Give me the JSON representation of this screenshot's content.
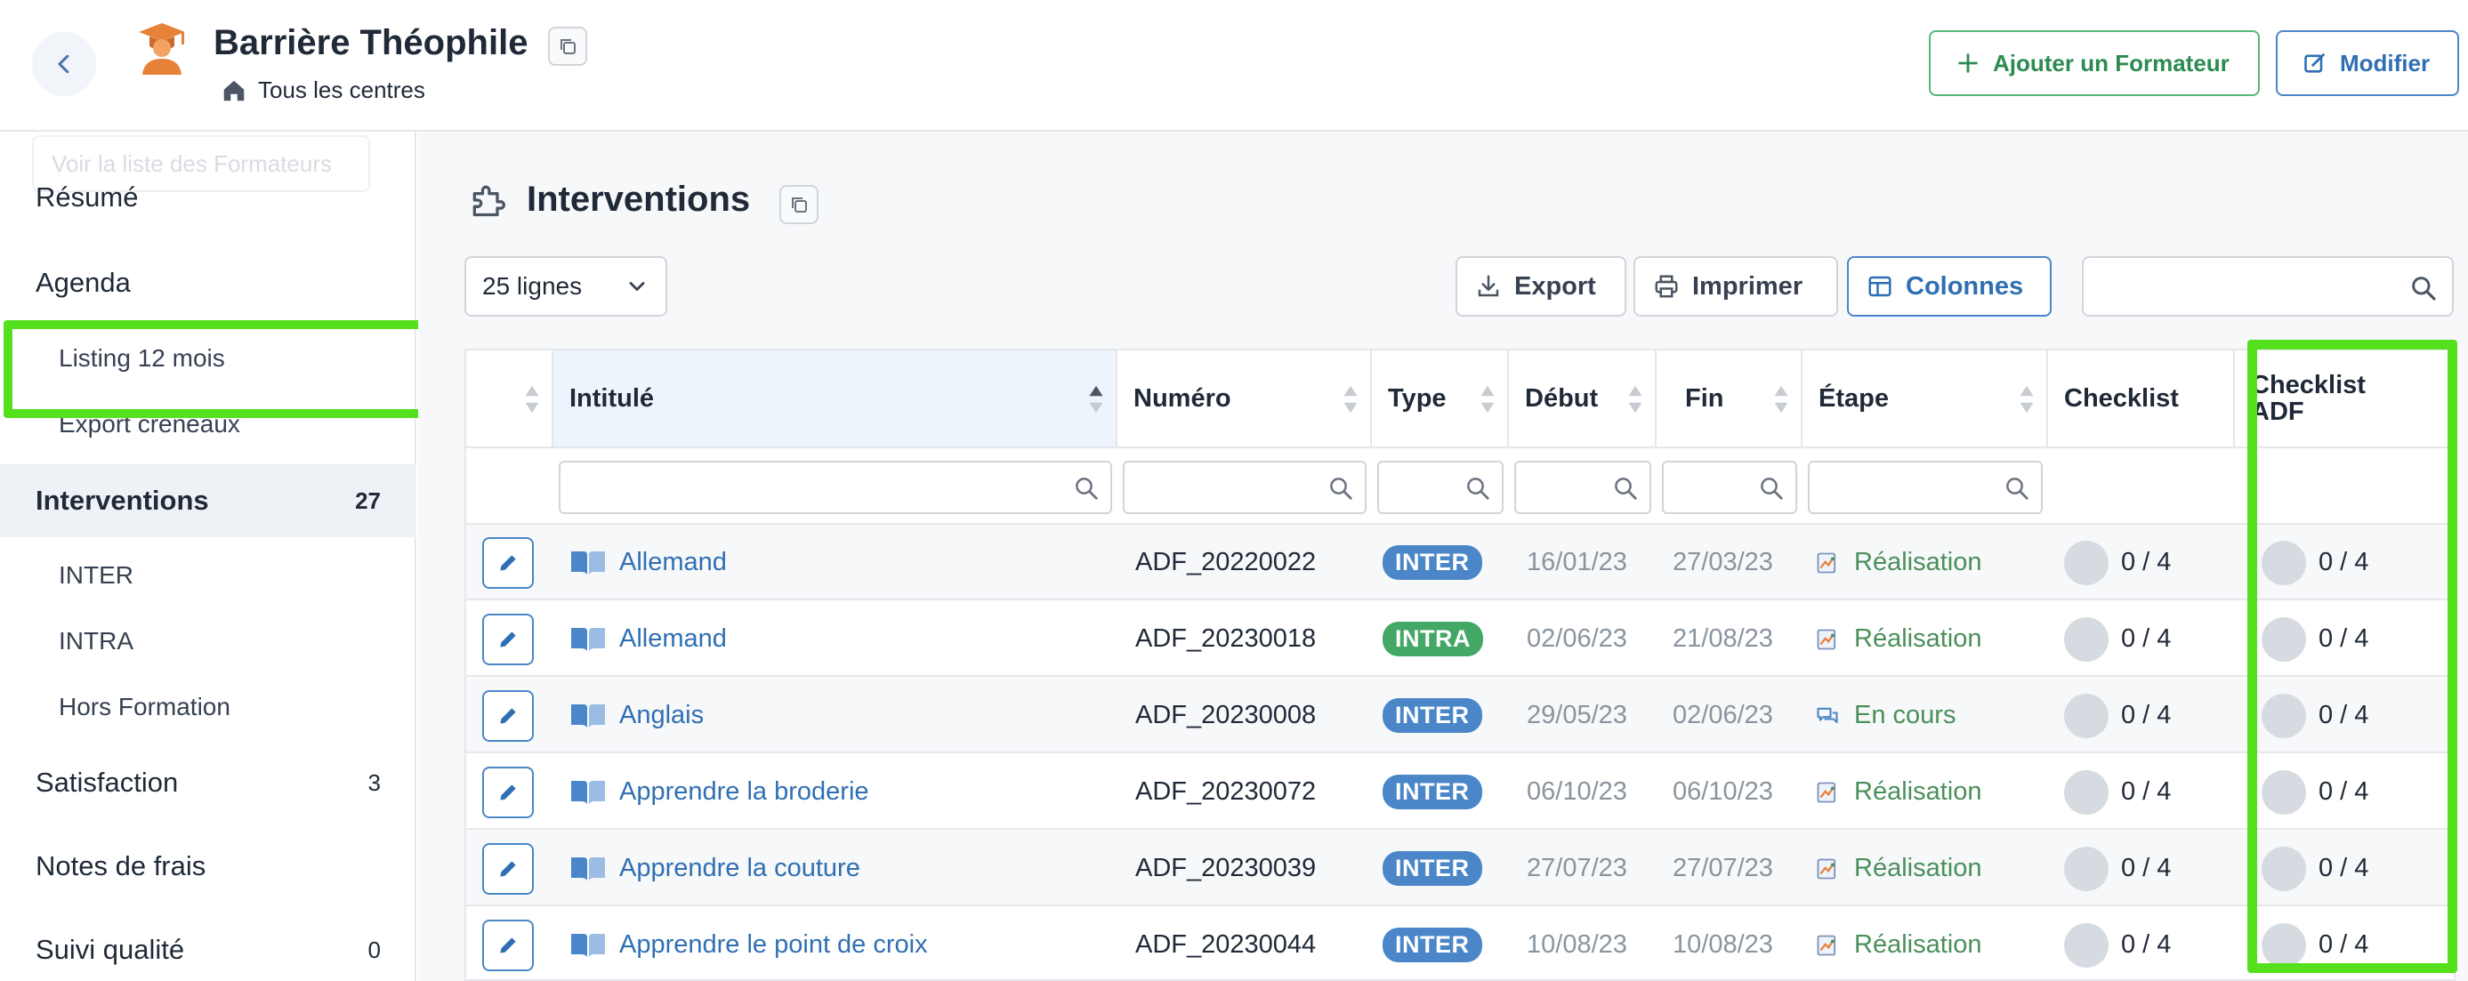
{
  "header": {
    "person_name": "Barrière Théophile",
    "centre": "Tous les centres",
    "add_trainer": "Ajouter un Formateur",
    "edit": "Modifier"
  },
  "sidebar": {
    "ghost_button": "Voir la liste des Formateurs",
    "items": [
      {
        "label": "Résumé",
        "count": ""
      },
      {
        "label": "Agenda",
        "count": ""
      },
      {
        "label": "Listing 12 mois",
        "count": ""
      },
      {
        "label": "Export créneaux",
        "count": ""
      },
      {
        "label": "Interventions",
        "count": "27"
      },
      {
        "label": "INTER",
        "count": ""
      },
      {
        "label": "INTRA",
        "count": ""
      },
      {
        "label": "Hors Formation",
        "count": ""
      },
      {
        "label": "Satisfaction",
        "count": "3"
      },
      {
        "label": "Notes de frais",
        "count": ""
      },
      {
        "label": "Suivi qualité",
        "count": "0"
      }
    ]
  },
  "main": {
    "title": "Interventions",
    "rows_select": "25 lignes",
    "export": "Export",
    "print": "Imprimer",
    "columns": "Colonnes"
  },
  "table": {
    "headers": {
      "intitule": "Intitulé",
      "numero": "Numéro",
      "type": "Type",
      "debut": "Début",
      "fin": "Fin",
      "etape": "Étape",
      "checklist": "Checklist",
      "checklist_adf_line1": "Checklist",
      "checklist_adf_line2": "ADF"
    },
    "rows": [
      {
        "intitule": "Allemand",
        "numero": "ADF_20220022",
        "type": "INTER",
        "debut": "16/01/23",
        "fin": "27/03/23",
        "etape": "Réalisation",
        "checklist": "0 / 4",
        "checklist_adf": "0 / 4"
      },
      {
        "intitule": "Allemand",
        "numero": "ADF_20230018",
        "type": "INTRA",
        "debut": "02/06/23",
        "fin": "21/08/23",
        "etape": "Réalisation",
        "checklist": "0 / 4",
        "checklist_adf": "0 / 4"
      },
      {
        "intitule": "Anglais",
        "numero": "ADF_20230008",
        "type": "INTER",
        "debut": "29/05/23",
        "fin": "02/06/23",
        "etape": "En cours",
        "checklist": "0 / 4",
        "checklist_adf": "0 / 4"
      },
      {
        "intitule": "Apprendre la broderie",
        "numero": "ADF_20230072",
        "type": "INTER",
        "debut": "06/10/23",
        "fin": "06/10/23",
        "etape": "Réalisation",
        "checklist": "0 / 4",
        "checklist_adf": "0 / 4"
      },
      {
        "intitule": "Apprendre la couture",
        "numero": "ADF_20230039",
        "type": "INTER",
        "debut": "27/07/23",
        "fin": "27/07/23",
        "etape": "Réalisation",
        "checklist": "0 / 4",
        "checklist_adf": "0 / 4"
      },
      {
        "intitule": "Apprendre le point de croix",
        "numero": "ADF_20230044",
        "type": "INTER",
        "debut": "10/08/23",
        "fin": "10/08/23",
        "etape": "Réalisation",
        "checklist": "0 / 4",
        "checklist_adf": "0 / 4"
      }
    ]
  },
  "colors": {
    "accent_blue": "#2f6fb3",
    "inter_badge": "#4a86c8",
    "intra_badge": "#43a865",
    "step_green": "#4a8f5a",
    "highlight": "#55e01e"
  },
  "icons": {
    "back": "chevron-left-icon",
    "avatar": "graduate-avatar-icon",
    "copy": "copy-icon",
    "home": "home-icon",
    "add": "plus-icon",
    "edit": "edit-icon",
    "section": "puzzle-icon",
    "export": "download-icon",
    "print": "printer-icon",
    "columns": "columns-icon",
    "search": "search-icon",
    "book": "book-icon",
    "pencil": "pencil-icon",
    "step_realisation": "chart-doc-icon",
    "step_en_cours": "chat-icon"
  }
}
